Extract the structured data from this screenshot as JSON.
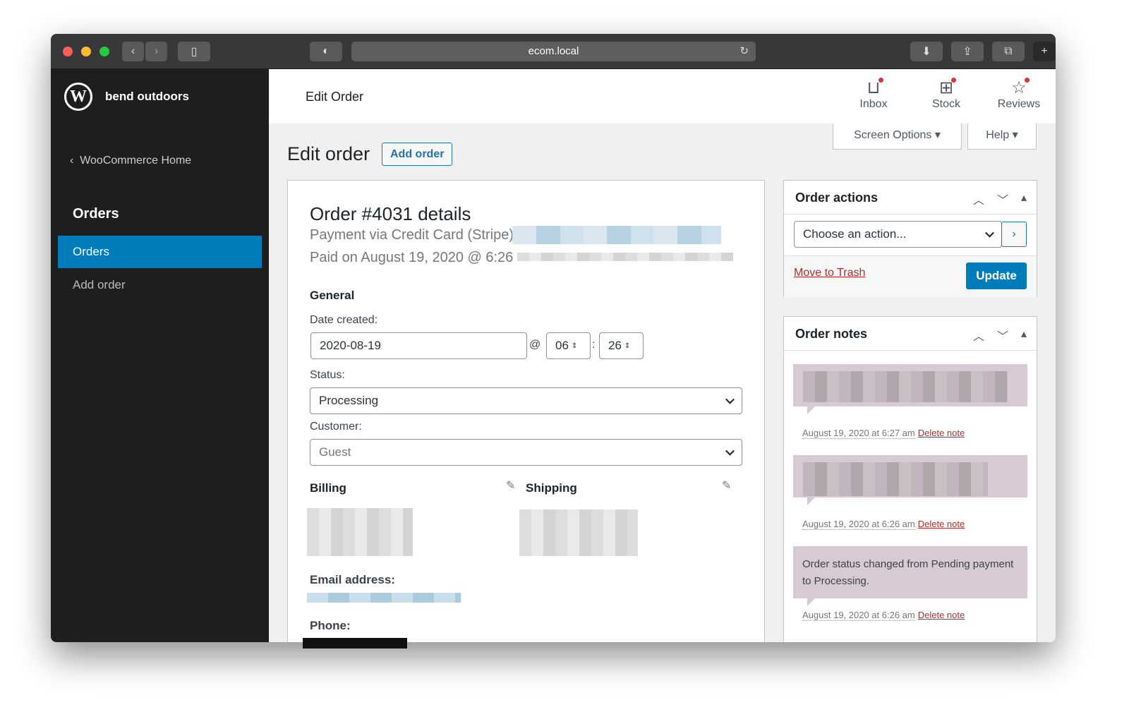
{
  "browser": {
    "url": "ecom.local"
  },
  "sidebar": {
    "site_name": "bend outdoors",
    "back_link": "WooCommerce Home",
    "section": "Orders",
    "items": [
      {
        "label": "Orders",
        "active": true
      },
      {
        "label": "Add order",
        "active": false
      }
    ]
  },
  "header": {
    "title": "Edit Order",
    "actions": [
      {
        "label": "Inbox",
        "icon": "inbox-icon"
      },
      {
        "label": "Stock",
        "icon": "stock-icon"
      },
      {
        "label": "Reviews",
        "icon": "star-icon"
      }
    ]
  },
  "page": {
    "title": "Edit order",
    "add_button": "Add order",
    "screen_options": "Screen Options",
    "help": "Help"
  },
  "order": {
    "heading": "Order #4031 details",
    "payment": "Payment via Credit Card (Stripe)",
    "paid_on": "Paid on August 19, 2020 @ 6:26",
    "general_label": "General",
    "date_label": "Date created:",
    "date": "2020-08-19",
    "at": "@",
    "hour": "06",
    "colon": ":",
    "minute": "26",
    "status_label": "Status:",
    "status": "Processing",
    "customer_label": "Customer:",
    "customer": "Guest",
    "billing_label": "Billing",
    "shipping_label": "Shipping",
    "email_label": "Email address:",
    "phone_label": "Phone:"
  },
  "order_actions": {
    "title": "Order actions",
    "select": "Choose an action...",
    "trash": "Move to Trash",
    "update": "Update"
  },
  "order_notes": {
    "title": "Order notes",
    "notes": [
      {
        "text": "",
        "date": "August 19, 2020 at 6:27 am",
        "delete": "Delete note"
      },
      {
        "text": "",
        "date": "August 19, 2020 at 6:26 am",
        "delete": "Delete note"
      },
      {
        "text": "Order status changed from Pending payment to Processing.",
        "date": "August 19, 2020 at 6:26 am",
        "delete": "Delete note"
      }
    ]
  },
  "colors": {
    "accent": "#007cba",
    "danger": "#b32d2e",
    "note_bg": "#d7cad2",
    "sidebar": "#1e1e1e"
  }
}
